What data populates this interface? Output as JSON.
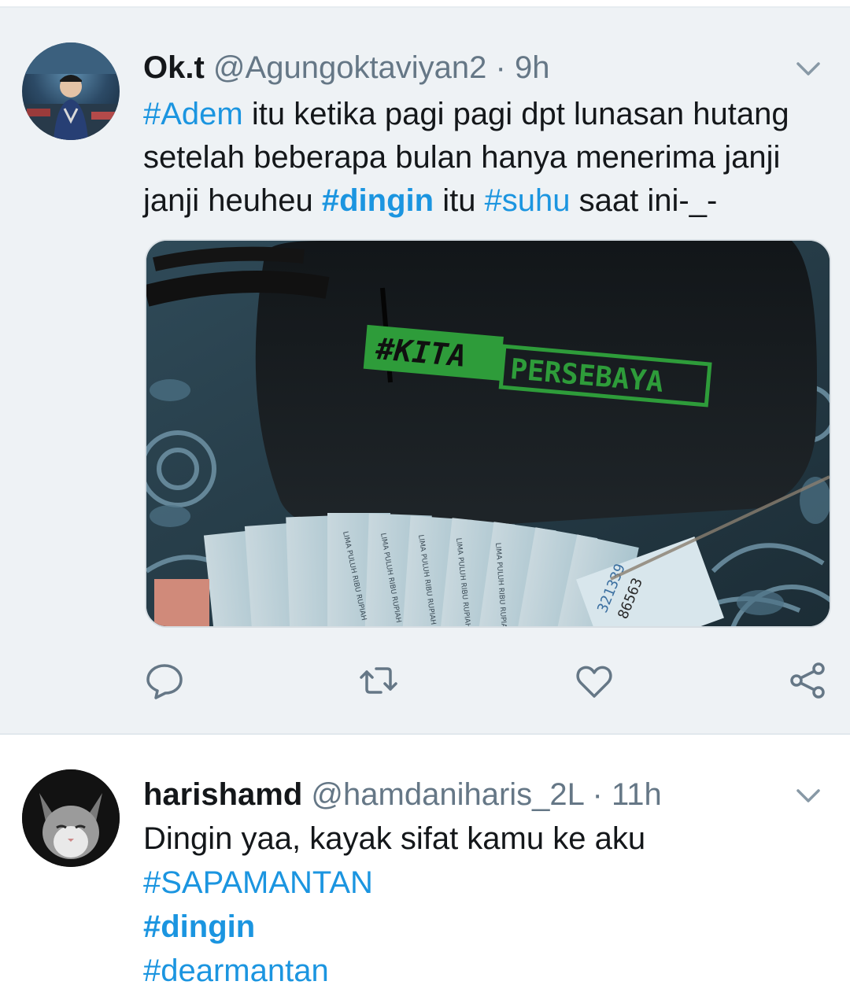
{
  "tweets": [
    {
      "name": "Ok.t",
      "handle": "@Agungoktaviyan2",
      "dot": "·",
      "time": "9h",
      "text": {
        "tag1": "#Adem",
        "part1": " itu ketika pagi pagi dpt lunasan hutang setelah beberapa bulan hanya menerima janji janji heuheu ",
        "tag2": "#dingin",
        "part2": " itu ",
        "tag3": "#suhu",
        "part3": " saat ini-_-"
      },
      "media": {
        "bag_text_1": "#KITA",
        "bag_text_2": "PERSEBAYA",
        "note_text": "LIMA PULUH RIBU RUPIAH",
        "note_serial_1": "321339",
        "note_serial_2": "86563"
      },
      "actions": [
        "reply-icon",
        "retweet-icon",
        "like-icon",
        "share-icon"
      ]
    },
    {
      "name": "harishamd",
      "handle": "@hamdaniharis_2L",
      "dot": "·",
      "time": "11h",
      "lines": [
        "Dingin yaa, kayak sifat kamu ke aku",
        "#SAPAMANTAN",
        "#dingin",
        "#dearmantan"
      ]
    }
  ],
  "colors": {
    "link": "#1b95e0",
    "muted": "#657786",
    "highlight_bg": "#eef2f5"
  }
}
